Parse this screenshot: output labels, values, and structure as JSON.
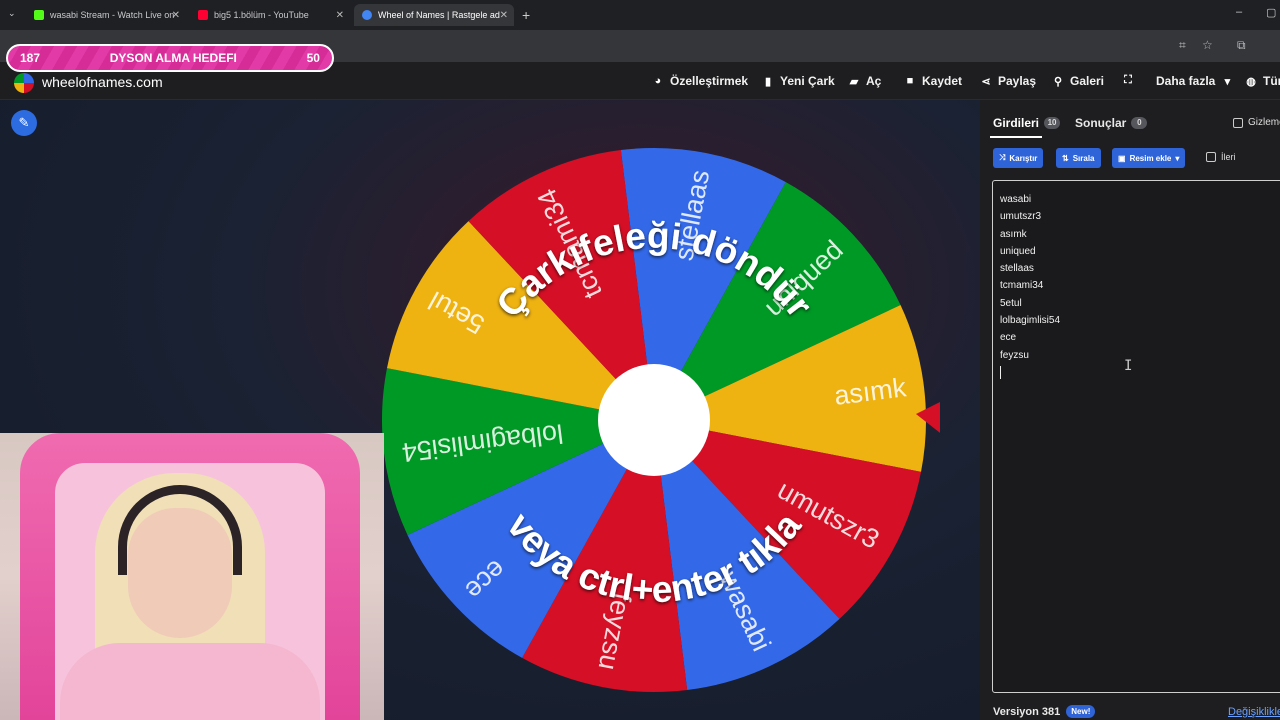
{
  "browser": {
    "tabs": [
      {
        "title": "wasabi Stream - Watch Live on",
        "color": "#53fc18"
      },
      {
        "title": "big5 1.bölüm - YouTube",
        "color": "#ff0033"
      },
      {
        "title": "Wheel of Names | Rastgele ad",
        "color": "#4285f4"
      }
    ],
    "new_tab": "+",
    "close": "✕"
  },
  "overlay": {
    "left": "187",
    "label": "DYSON ALMA HEDEFI",
    "right": "50"
  },
  "site": {
    "name": "wheelofnames.com",
    "nav": [
      {
        "icon": "palette-icon",
        "label": "Özelleştirmek"
      },
      {
        "icon": "file-icon",
        "label": "Yeni Çark"
      },
      {
        "icon": "folder-icon",
        "label": "Aç"
      },
      {
        "icon": "save-icon",
        "label": "Kaydet"
      },
      {
        "icon": "share-icon",
        "label": "Paylaş"
      },
      {
        "icon": "search-icon",
        "label": "Galeri"
      },
      {
        "icon": "fullscreen-icon",
        "label": ""
      },
      {
        "icon": "chevron-down-icon",
        "label": "Daha fazla"
      },
      {
        "icon": "globe-icon",
        "label": "Tür"
      }
    ]
  },
  "wheel": {
    "center_text_top": "Çarkıfeleği döndür",
    "center_text_bottom": "veya ctrl+enter tıkla",
    "colors": {
      "blue": "#3369e8",
      "red": "#d50f25",
      "yellow": "#eeb211",
      "green": "#009925"
    },
    "slices": [
      {
        "label": "stellaas",
        "color": "#3369e8"
      },
      {
        "label": "uniqued",
        "color": "#009925"
      },
      {
        "label": "asımk",
        "color": "#eeb211"
      },
      {
        "label": "umutszr3",
        "color": "#d50f25"
      },
      {
        "label": "wasabi",
        "color": "#3369e8"
      },
      {
        "label": "feyzsu",
        "color": "#d50f25"
      },
      {
        "label": "ece",
        "color": "#3369e8"
      },
      {
        "label": "lolbagimlisi54",
        "color": "#009925"
      },
      {
        "label": "5etul",
        "color": "#eeb211"
      },
      {
        "label": "tcmami34",
        "color": "#d50f25"
      }
    ]
  },
  "panel": {
    "tab_entries": "Girdileri",
    "tab_entries_count": "10",
    "tab_results": "Sonuçlar",
    "tab_results_count": "0",
    "hide_label": "Gizleme",
    "buttons": {
      "shuffle": "Karıştır",
      "sort": "Sırala",
      "add_image": "Resim ekle"
    },
    "advanced_label": "İleri",
    "entries": [
      "wasabi",
      "umutszr3",
      "asımk",
      "uniqued",
      "stellaas",
      "tcmami34",
      "5etul",
      "lolbagimlisi54",
      "ece",
      "feyzsu"
    ],
    "version": "Versiyon 381",
    "new_badge": "New!",
    "changes_link": "Değişiklikler"
  }
}
